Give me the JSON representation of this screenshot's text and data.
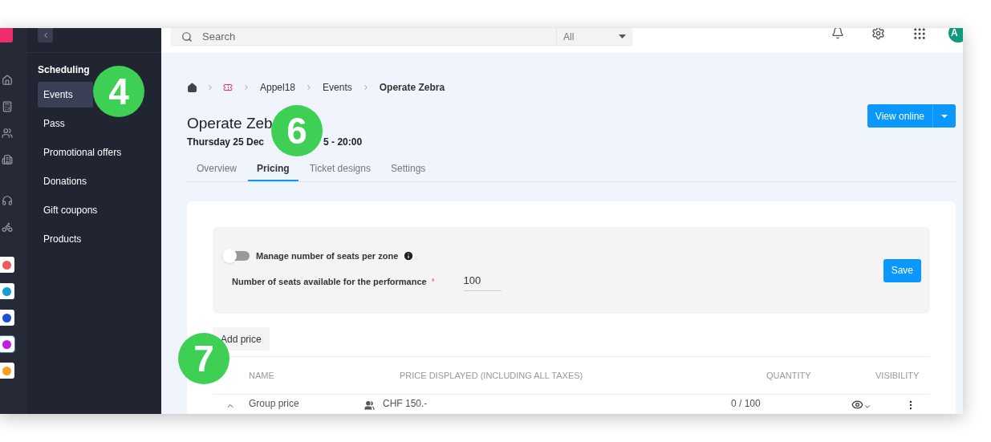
{
  "sidebar": {
    "section": "Scheduling",
    "items": [
      {
        "label": "Events",
        "selected": true
      },
      {
        "label": "Pass",
        "selected": false
      },
      {
        "label": "Promotional offers",
        "selected": false
      },
      {
        "label": "Donations",
        "selected": false
      },
      {
        "label": "Gift coupons",
        "selected": false
      },
      {
        "label": "Products",
        "selected": false
      }
    ]
  },
  "search": {
    "placeholder": "Search",
    "scope": "All"
  },
  "avatar": "A",
  "breadcrumb": [
    "Appel18",
    "Events",
    "Operate Zebra"
  ],
  "event": {
    "title": "Operate Zeb",
    "date_start": "Thursday 25 Dec",
    "date_end": "5 - 20:00",
    "view_button": "View online"
  },
  "tabs": [
    {
      "label": "Overview",
      "selected": false
    },
    {
      "label": "Pricing",
      "selected": true
    },
    {
      "label": "Ticket designs",
      "selected": false
    },
    {
      "label": "Settings",
      "selected": false
    }
  ],
  "seats": {
    "toggle_label": "Manage number of seats per zone",
    "on": false,
    "field_label": "Number of seats available for the performance",
    "required_mark": "*",
    "value": "100",
    "save": "Save"
  },
  "add_price": "Add price",
  "table": {
    "columns": [
      "NAME",
      "PRICE DISPLAYED (INCLUDING ALL TAXES)",
      "QUANTITY",
      "VISIBILITY"
    ],
    "rows": [
      {
        "name": "Group price",
        "price": "CHF 150.-",
        "quantity": "0 / 100"
      }
    ]
  },
  "badges": [
    "4",
    "6",
    "7"
  ]
}
